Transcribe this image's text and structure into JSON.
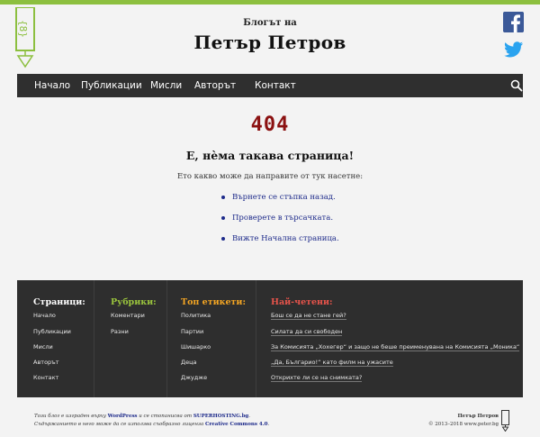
{
  "header": {
    "pre_title": "Блогът на",
    "title": "Петър Петров"
  },
  "social": {
    "facebook_icon": "facebook-icon",
    "twitter_icon": "twitter-icon"
  },
  "nav": {
    "items": [
      "Начало",
      "Публикации",
      "Мисли",
      "Авторът",
      "Контакт"
    ],
    "search_icon": "search-icon"
  },
  "error": {
    "code": "404",
    "title": "Е, нѐма такава страница!",
    "text": "Ето какво може да направите от тук насетне:",
    "links": [
      "Върнете се стъпка назад.",
      "Проверете в търсачката.",
      "Вижте Начална страница."
    ]
  },
  "footer": {
    "pages": {
      "heading": "Страници:",
      "items": [
        "Начало",
        "Публикации",
        "Мисли",
        "Авторът",
        "Контакт"
      ]
    },
    "categories": {
      "heading": "Рубрики:",
      "items": [
        "Коментари",
        "Разни"
      ]
    },
    "tags": {
      "heading": "Топ етикети:",
      "items": [
        "Политика",
        "Партии",
        "Шишарко",
        "Деца",
        "Джудже"
      ]
    },
    "popular": {
      "heading": "Най-четени:",
      "items": [
        "Бош се да не стане гей?",
        "Силата да си свободен",
        "За Комисията „Хохегер“ и защо не беше преименувана на Комисията „Моника“",
        "„Да, Българио!“ като филм на ужасите",
        "Открихте ли се на снимката?"
      ]
    }
  },
  "credits": {
    "line1_a": "Този блог е изграден върху ",
    "line1_wp": "WordPress",
    "line1_b": " и се стопанисва от ",
    "line1_host": "SUPERHOSTING.bg",
    "line1_c": ".",
    "line2_a": "Съдържанието в него може да се използва съобразно лиценза ",
    "line2_cc": "Creative Commons 4.0",
    "line2_b": ".",
    "right_name": "Петър Петров",
    "right_copy": "© 2013–2018 www.peter.bg"
  },
  "colors": {
    "accent_green": "#8cbf3f",
    "nav_bg": "#2f2f2f",
    "error_red": "#8b1111",
    "link_blue": "#1d2a8a",
    "footer_bg": "#2e2e2e",
    "heading_white": "#ffffff",
    "heading_green": "#9bc53d",
    "heading_orange": "#f5a623",
    "heading_red": "#e8544b"
  }
}
